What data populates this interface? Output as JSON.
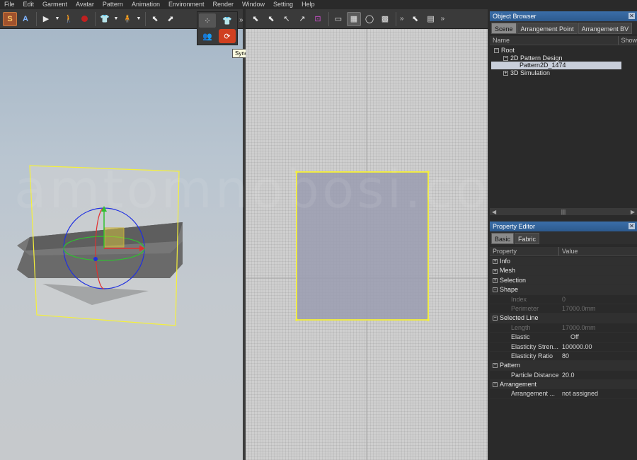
{
  "menu": [
    "File",
    "Edit",
    "Garment",
    "Avatar",
    "Pattern",
    "Animation",
    "Environment",
    "Render",
    "Window",
    "Setting",
    "Help"
  ],
  "toolbar3d": {
    "s_label": "S",
    "a_label": "A",
    "icons": [
      "play-icon",
      "walk-icon",
      "record-icon",
      "tshirt-icon",
      "avatar-icon",
      "select-icon",
      "move-icon"
    ],
    "more": "»"
  },
  "flyout": {
    "icons": [
      "points-icon",
      "shirt-fold-icon",
      "couple-icon",
      "sync-icon"
    ],
    "tooltip": "Sync"
  },
  "toolbar2d": {
    "icons": [
      "select-icon",
      "transform-icon",
      "edit-point-icon",
      "edit-curve-icon",
      "add-point-icon",
      "rectangle-icon",
      "grid-icon",
      "ellipse-icon",
      "texture-icon",
      "arrange-icon"
    ],
    "more": "»"
  },
  "object_browser": {
    "title": "Object Browser",
    "tabs": [
      "Scene",
      "Arrangement Point",
      "Arrangement BV"
    ],
    "col_name": "Name",
    "col_show": "Show",
    "tree": [
      {
        "label": "Root",
        "level": 0,
        "expander": "−"
      },
      {
        "label": "2D Pattern Design",
        "level": 1,
        "expander": "−"
      },
      {
        "label": "Pattern2D_1474",
        "level": 2,
        "expander": ""
      },
      {
        "label": "3D Simulation",
        "level": 1,
        "expander": "+"
      }
    ],
    "selected_index": 2
  },
  "property_editor": {
    "title": "Property Editor",
    "tabs": [
      "Basic",
      "Fabric"
    ],
    "col_property": "Property",
    "col_value": "Value",
    "rows": [
      {
        "type": "cat",
        "expander": "+",
        "key": "Info",
        "value": ""
      },
      {
        "type": "cat",
        "expander": "+",
        "key": "Mesh",
        "value": ""
      },
      {
        "type": "cat",
        "expander": "+",
        "key": "Selection",
        "value": ""
      },
      {
        "type": "cat",
        "expander": "−",
        "key": "Shape",
        "value": ""
      },
      {
        "type": "dim",
        "expander": "",
        "key": "Index",
        "value": "0"
      },
      {
        "type": "dim",
        "expander": "",
        "key": "Perimeter",
        "value": "17000.0mm"
      },
      {
        "type": "cat",
        "expander": "−",
        "key": "Selected Line",
        "value": ""
      },
      {
        "type": "dim",
        "expander": "",
        "key": "Length",
        "value": "17000.0mm"
      },
      {
        "type": "item",
        "expander": "",
        "key": "Elastic",
        "value": "Off"
      },
      {
        "type": "item",
        "expander": "",
        "key": "Elasticity Stren...",
        "value": "100000.00"
      },
      {
        "type": "item",
        "expander": "",
        "key": "Elasticity Ratio",
        "value": "80"
      },
      {
        "type": "cat",
        "expander": "−",
        "key": "Pattern",
        "value": ""
      },
      {
        "type": "item",
        "expander": "",
        "key": "Particle Distance",
        "value": "20.0"
      },
      {
        "type": "cat",
        "expander": "−",
        "key": "Arrangement",
        "value": ""
      },
      {
        "type": "item",
        "expander": "",
        "key": "Arrangement ...",
        "value": "not assigned"
      }
    ]
  },
  "colors": {
    "pattern_outline": "#f5f03a",
    "pattern_fill": "#9a9cb0",
    "title_blue": "#2c5a8e",
    "gizmo_x": "#e03030",
    "gizmo_y": "#30c030",
    "gizmo_z": "#2030e0"
  },
  "watermark": "amtomnobosi.com"
}
